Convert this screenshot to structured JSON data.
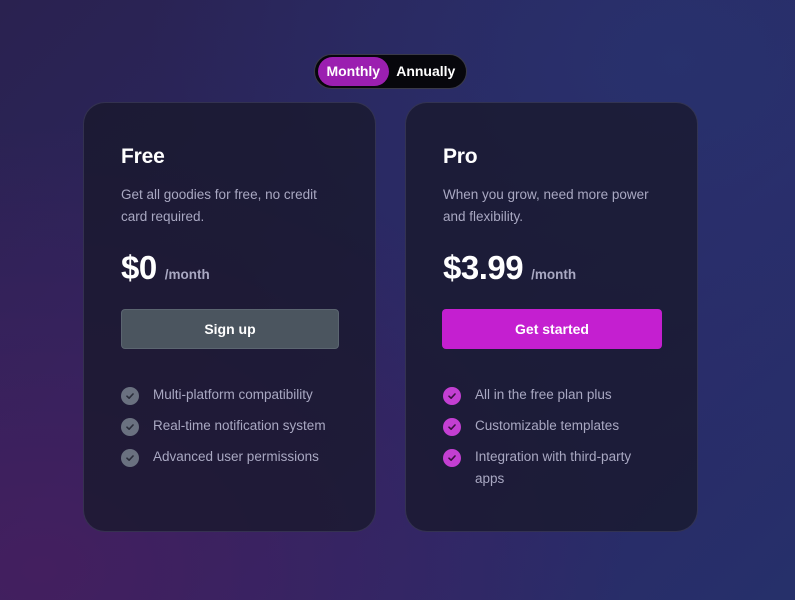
{
  "billing_toggle": {
    "monthly_label": "Monthly",
    "annually_label": "Annually",
    "selected": "Monthly"
  },
  "plans": [
    {
      "name": "Free",
      "description": "Get all goodies for free, no credit card required.",
      "price": "$0",
      "period": "/month",
      "cta_label": "Sign up",
      "features": [
        "Multi-platform compatibility",
        "Real-time notification system",
        "Advanced user permissions"
      ]
    },
    {
      "name": "Pro",
      "description": "When you grow, need more power and flexibility.",
      "price": "$3.99",
      "period": "/month",
      "cta_label": "Get started",
      "features": [
        "All in the free plan plus",
        "Customizable templates",
        "Integration with third-party apps"
      ]
    }
  ],
  "icons": {
    "feature_check": "check-circle-icon"
  },
  "colors": {
    "accent": "#c41fd0",
    "toggle_active": "#9b1fb0",
    "free_button": "#4b555f",
    "free_check": "#6a7180",
    "pro_check": "#c33fd2",
    "muted_text": "#a9a8c2"
  }
}
